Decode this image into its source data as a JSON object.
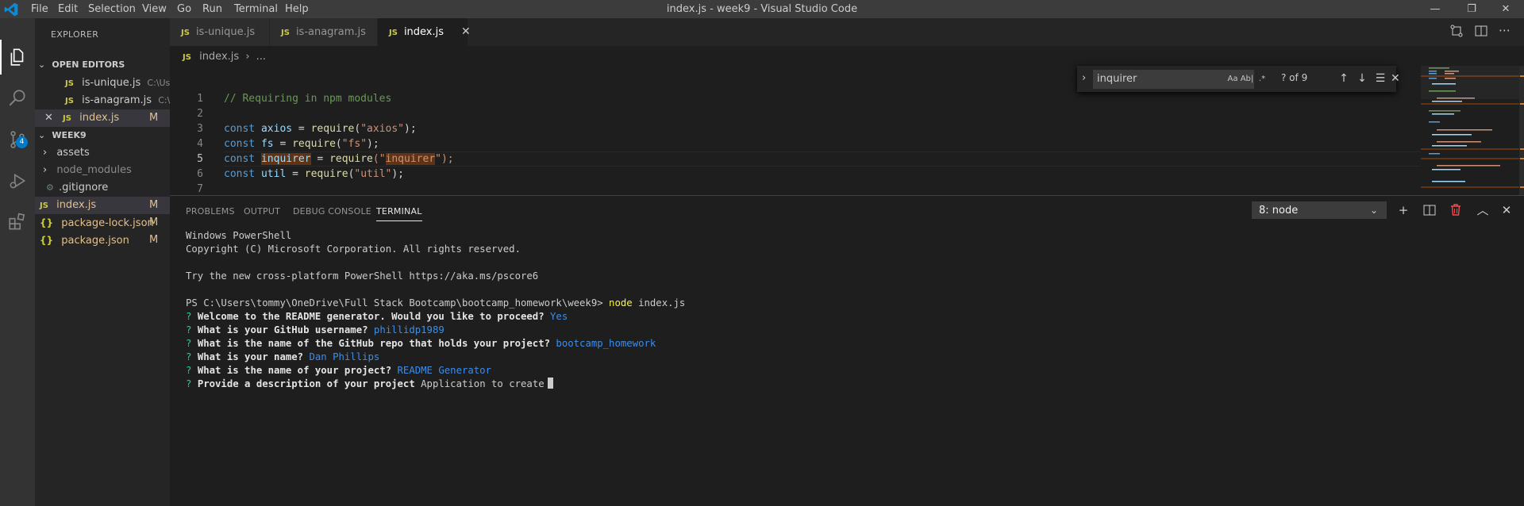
{
  "window": {
    "title": "index.js - week9 - Visual Studio Code",
    "menu": [
      "File",
      "Edit",
      "Selection",
      "View",
      "Go",
      "Run",
      "Terminal",
      "Help"
    ],
    "controls": {
      "minimize": "—",
      "restore": "❐",
      "close": "✕"
    }
  },
  "activity_bar": {
    "items": [
      "explorer-icon",
      "search-icon",
      "source-control-icon",
      "run-debug-icon",
      "extensions-icon"
    ],
    "scm_badge": "4"
  },
  "sidebar": {
    "title": "EXPLORER",
    "open_editors": {
      "header": "OPEN EDITORS",
      "files": [
        {
          "badge": "JS",
          "name": "is-unique.js",
          "path": "C:\\Use..."
        },
        {
          "badge": "JS",
          "name": "is-anagram.js",
          "path": "C:\\U..."
        },
        {
          "badge": "JS",
          "name": "index.js",
          "status": "M"
        }
      ]
    },
    "folder": {
      "header": "WEEK9",
      "items": [
        {
          "name": "assets"
        },
        {
          "name": "node_modules"
        },
        {
          "name": ".gitignore"
        },
        {
          "badge": "JS",
          "name": "index.js",
          "status": "M"
        },
        {
          "badge": "{}",
          "name": "package-lock.json",
          "status": "M"
        },
        {
          "badge": "{}",
          "name": "package.json",
          "status": "M"
        }
      ]
    }
  },
  "tabs": [
    {
      "badge": "JS",
      "label": "is-unique.js"
    },
    {
      "badge": "JS",
      "label": "is-anagram.js"
    },
    {
      "badge": "JS",
      "label": "index.js",
      "close": "✕"
    }
  ],
  "breadcrumb": {
    "badge": "JS",
    "file": "index.js",
    "separator": "›",
    "rest": "..."
  },
  "editor": {
    "line_numbers": [
      "1",
      "2",
      "3",
      "4",
      "5",
      "6",
      "7"
    ],
    "line1": "// Requiring in npm modules",
    "line3": {
      "kw": "const",
      "var": "axios",
      "eq": " = ",
      "fn": "require",
      "open": "(",
      "str": "\"axios\"",
      "close": ");"
    },
    "line4": {
      "kw": "const",
      "var": "fs",
      "eq": " = ",
      "fn": "require",
      "open": "(",
      "str": "\"fs\"",
      "close": ");"
    },
    "line5": {
      "kw": "const",
      "var": "inquirer",
      "eq": " = ",
      "fn": "require",
      "open": "(\"",
      "str": "inquirer",
      "close": "\");"
    },
    "line6": {
      "kw": "const",
      "var": "util",
      "eq": " = ",
      "fn": "require",
      "open": "(",
      "str": "\"util\"",
      "close": ");"
    }
  },
  "find_widget": {
    "value": "inquirer",
    "match_case": "Aa",
    "whole_word": "Ab|",
    "regex": ".*",
    "count": "? of 9"
  },
  "panel": {
    "tabs": [
      "PROBLEMS",
      "OUTPUT",
      "DEBUG CONSOLE",
      "TERMINAL"
    ],
    "terminal_select": "8: node"
  },
  "terminal": {
    "l1": "Windows PowerShell",
    "l2": "Copyright (C) Microsoft Corporation. All rights reserved.",
    "l3": "Try the new cross-platform PowerShell https://aka.ms/pscore6",
    "prompt": "PS C:\\Users\\tommy\\OneDrive\\Full Stack Bootcamp\\bootcamp_homework\\week9> ",
    "command": "node",
    "command_arg": " index.js",
    "qa": [
      {
        "q": "Welcome to the README generator. Would you like to proceed?",
        "a": "Yes"
      },
      {
        "q": "What is your GitHub username?",
        "a": "phillidp1989"
      },
      {
        "q": "What is the name of the GitHub repo that holds your project?",
        "a": "bootcamp_homework"
      },
      {
        "q": "What is your name?",
        "a": "Dan Phillips"
      },
      {
        "q": "What is the name of your project?",
        "a": "README Generator"
      }
    ],
    "current_q": "Provide a description of your project",
    "current_input": "Application to create",
    "qmark": "?"
  }
}
